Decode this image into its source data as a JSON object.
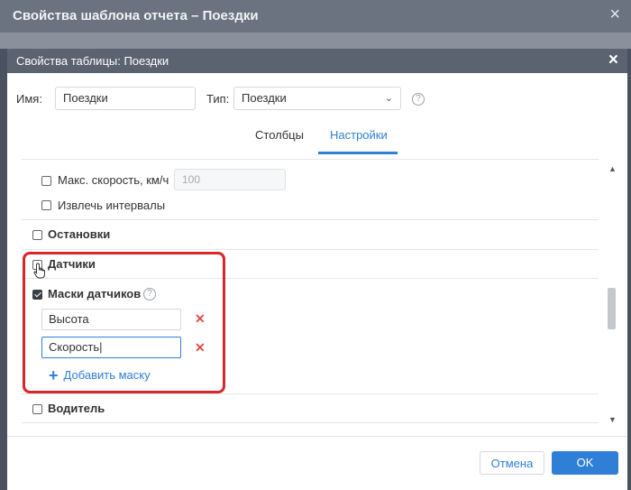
{
  "outer": {
    "title": "Свойства шаблона отчета – Поездки",
    "close": "×"
  },
  "dialog": {
    "title": "Свойства таблицы: Поездки",
    "close": "×"
  },
  "form": {
    "name_label": "Имя:",
    "name_value": "Поездки",
    "type_label": "Тип:",
    "type_value": "Поездки",
    "help": "?"
  },
  "tabs": [
    {
      "label": "Столбцы",
      "active": false
    },
    {
      "label": "Настройки",
      "active": true
    }
  ],
  "settings": {
    "max_speed_label": "Макс. скорость, км/ч",
    "max_speed_value": "100",
    "extract_intervals_label": "Извлечь интервалы",
    "stops_label": "Остановки",
    "sensors_label": "Датчики",
    "sensor_masks_label": "Маски датчиков",
    "masks": [
      "Высота",
      "Скорость"
    ],
    "add_mask_label": "Добавить маску",
    "driver_label": "Водитель"
  },
  "buttons": {
    "cancel": "Отмена",
    "ok": "OK"
  },
  "colors": {
    "accent": "#2f7fd6",
    "highlight": "#d9262b",
    "delete": "#e04b4b"
  }
}
